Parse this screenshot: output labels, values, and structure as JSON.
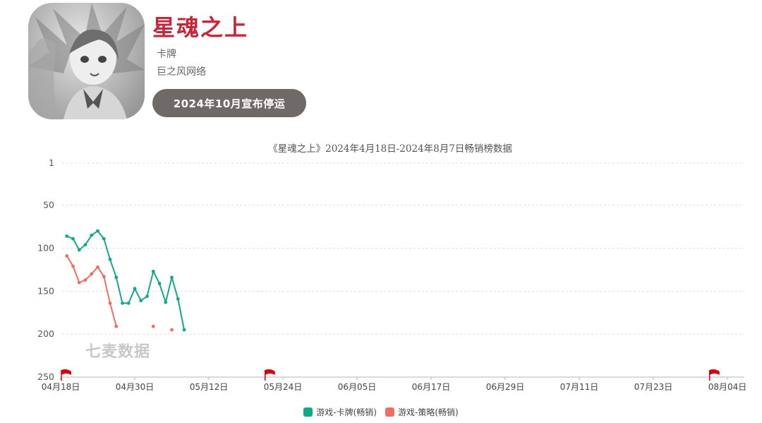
{
  "app": {
    "title": "星魂之上",
    "category": "卡牌",
    "publisher": "巨之风网络",
    "status_badge": "2024年10月宣布停运",
    "title_color": "#c6273a"
  },
  "watermark": "七麦数据",
  "chart_data": {
    "type": "line",
    "title": "《星魂之上》2024年4月18日-2024年8月7日畅销榜数据",
    "y_inverted": true,
    "ylim": [
      1,
      250
    ],
    "y_ticks": [
      "1",
      "50",
      "100",
      "150",
      "200",
      "250"
    ],
    "x_ticks": [
      "04月18日",
      "04月30日",
      "05月12日",
      "05月24日",
      "06月05日",
      "06月17日",
      "06月29日",
      "07月11日",
      "07月23日",
      "08月04日"
    ],
    "grid": "horizontal dashed",
    "legend_position": "bottom-center",
    "flag_markers": [
      "04月18日",
      "05月21日",
      "08月01日"
    ],
    "flag_color": "#d9000d",
    "series": [
      {
        "name": "游戏-卡牌(畅销)",
        "color": "#12a88a",
        "points": [
          [
            "04月19日",
            86
          ],
          [
            "04月20日",
            89
          ],
          [
            "04月21日",
            102
          ],
          [
            "04月22日",
            96
          ],
          [
            "04月23日",
            85
          ],
          [
            "04月24日",
            80
          ],
          [
            "04月25日",
            89
          ],
          [
            "04月26日",
            113
          ],
          [
            "04月27日",
            134
          ],
          [
            "04月28日",
            164
          ],
          [
            "04月29日",
            164
          ],
          [
            "04月30日",
            147
          ],
          [
            "05月01日",
            161
          ],
          [
            "05月02日",
            156
          ],
          [
            "05月03日",
            127
          ],
          [
            "05月04日",
            141
          ],
          [
            "05月05日",
            163
          ],
          [
            "05月06日",
            134
          ],
          [
            "05月07日",
            159
          ],
          [
            "05月08日",
            195
          ]
        ]
      },
      {
        "name": "游戏-策略(畅销)",
        "color": "#f06d61",
        "points": [
          [
            "04月19日",
            109
          ],
          [
            "04月20日",
            121
          ],
          [
            "04月21日",
            140
          ],
          [
            "04月22日",
            137
          ],
          [
            "04月23日",
            130
          ],
          [
            "04月24日",
            122
          ],
          [
            "04月25日",
            133
          ],
          [
            "04月26日",
            164
          ],
          [
            "04月27日",
            191
          ],
          [
            "05月03日",
            191
          ],
          [
            "05月06日",
            195
          ]
        ]
      }
    ]
  }
}
